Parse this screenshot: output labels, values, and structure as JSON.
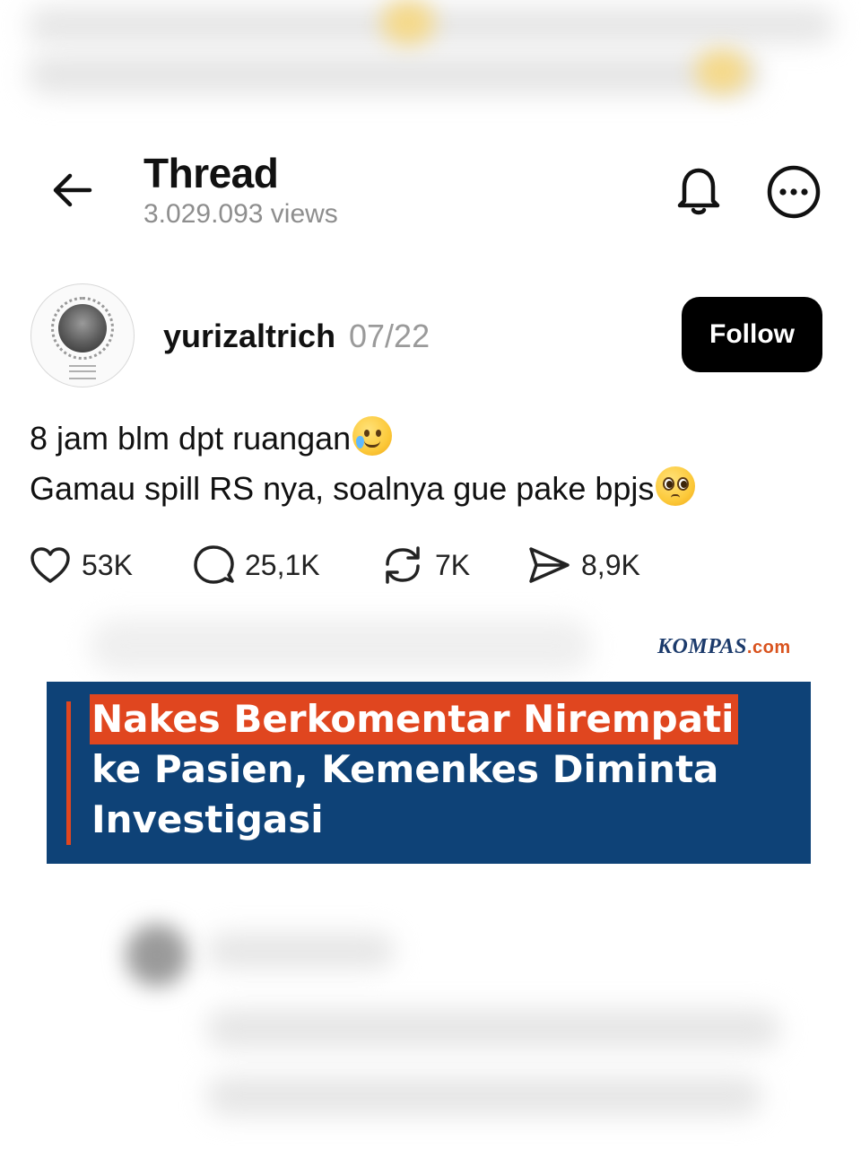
{
  "header": {
    "title": "Thread",
    "views": "3.029.093 views"
  },
  "post": {
    "username": "yurizaltrich",
    "date": "07/22",
    "follow_label": "Follow",
    "line1": "8 jam blm dpt ruangan",
    "line1_emoji": "smiling-face-with-tear",
    "line2": "Gamau spill RS nya, soalnya gue pake bpjs",
    "line2_emoji": "pleading-face"
  },
  "actions": {
    "likes": "53K",
    "replies": "25,1K",
    "reposts": "7K",
    "shares": "8,9K"
  },
  "news": {
    "logo_main": "KOMPAS",
    "logo_suffix": ".com",
    "headline_1": "Nakes Berkomentar Nirempati",
    "headline_2": "ke Pasien, Kemenkes Diminta",
    "headline_3": "Investigasi"
  },
  "colors": {
    "banner_bg": "#0e4277",
    "banner_accent": "#e0461f",
    "follow_bg": "#000000"
  }
}
